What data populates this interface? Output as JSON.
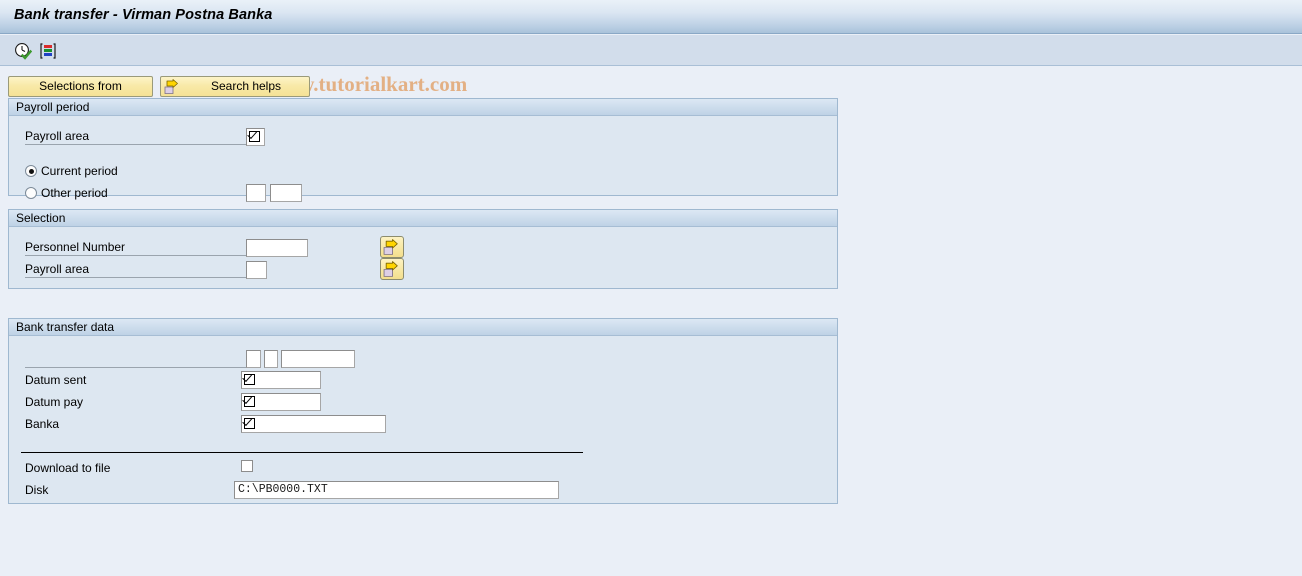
{
  "window": {
    "title": "Bank transfer - Virman Postna Banka"
  },
  "toolbar": {
    "icons": [
      {
        "name": "execute-clock-icon",
        "title": "Execute"
      },
      {
        "name": "layout-columns-icon",
        "title": "Get variant"
      }
    ]
  },
  "watermark": {
    "text": "© www.tutorialkart.com"
  },
  "buttons": {
    "selections_from": "Selections from",
    "search_helps": "Search helps"
  },
  "sections": {
    "payroll_period": {
      "title": "Payroll period",
      "payroll_area_label": "Payroll area",
      "payroll_area_value": "",
      "current_period_label": "Current period",
      "current_period_selected": true,
      "other_period_label": "Other period",
      "other_period_selected": false,
      "other_period_value_1": "",
      "other_period_value_2": ""
    },
    "selection": {
      "title": "Selection",
      "rows": [
        {
          "label": "Personnel Number",
          "value": "",
          "multi_button": "multi-selection-arrow-icon"
        },
        {
          "label": "Payroll area",
          "value": "",
          "multi_button": "multi-selection-arrow-icon"
        }
      ]
    },
    "bank_transfer_data": {
      "title": "Bank transfer data",
      "top_value_1": "",
      "top_value_2": "",
      "top_value_3": "",
      "datum_sent_label": "Datum sent",
      "datum_sent_value": "",
      "datum_pay_label": "Datum pay",
      "datum_pay_value": "",
      "banka_label": "Banka",
      "banka_value": "",
      "download_to_file_label": "Download to file",
      "download_to_file_checked": false,
      "disk_label": "Disk",
      "disk_value": "C:\\PB0000.TXT"
    }
  },
  "colors": {
    "page_background": "#eaeff7",
    "panel_background": "#dde7f1",
    "panel_border": "#9fb8d0",
    "titlebar_accent": "#a9c2da",
    "button_yellow": "#f5e295",
    "watermark": "#e3b084"
  }
}
